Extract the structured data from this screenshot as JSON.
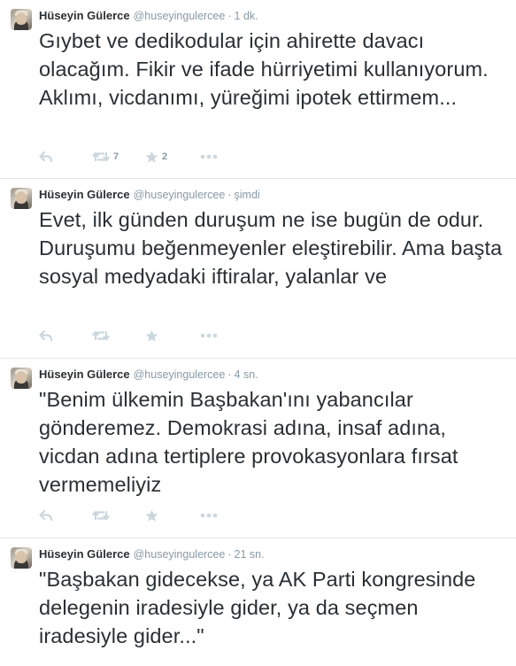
{
  "tweets": [
    {
      "name": "Hüseyin Gülerce",
      "handle": "@huseyingulercee",
      "time": "1 dk.",
      "text": "Gıybet ve dedikodular için ahirette davacı olacağım. Fikir ve ifade hürriyetimi kullanıyorum. Aklımı, vicdanımı, yüreğimi ipotek ettirmem...",
      "retweets": "7",
      "favorites": "2"
    },
    {
      "name": "Hüseyin Gülerce",
      "handle": "@huseyingulercee",
      "time": "şimdi",
      "text": "Evet, ilk günden duruşum ne ise bugün de odur. Duruşumu beğenmeyenler eleştirebilir. Ama başta sosyal medyadaki iftiralar, yalanlar ve",
      "retweets": "",
      "favorites": ""
    },
    {
      "name": "Hüseyin Gülerce",
      "handle": "@huseyingulercee",
      "time": "4 sn.",
      "text": "\"Benim ülkemin Başbakan'ını yabancılar gönderemez. Demokrasi adına, insaf adına, vicdan adına tertiplere provokasyonlara fırsat vermemeliyiz",
      "retweets": "",
      "favorites": ""
    },
    {
      "name": "Hüseyin Gülerce",
      "handle": "@huseyingulercee",
      "time": "21 sn.",
      "text": "\"Başbakan gidecekse, ya AK Parti kongresinde delegenin iradesiyle gider, ya da seçmen iradesiyle gider...\"",
      "retweets": "",
      "favorites": ""
    }
  ],
  "separator": "·",
  "icons": {
    "reply": "reply-icon",
    "retweet": "retweet-icon",
    "favorite": "star-icon",
    "more": "more-dots-icon"
  },
  "colors": {
    "text": "#292f33",
    "muted": "#8899a6",
    "icon": "#ccd6dd",
    "border": "#e1e8ed"
  }
}
